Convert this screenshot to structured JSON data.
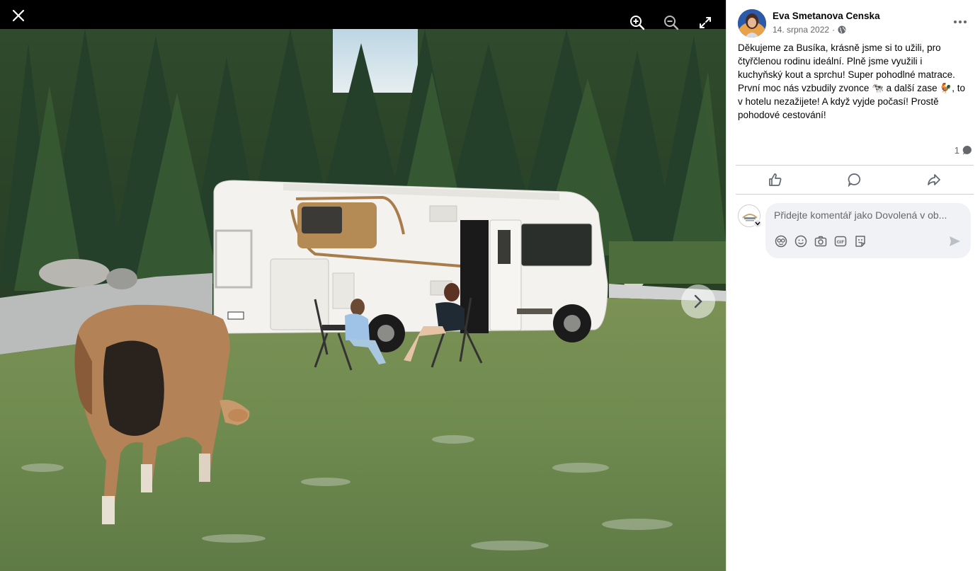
{
  "viewer": {
    "close_icon": "close-icon",
    "zoom_in_icon": "zoom-in-icon",
    "zoom_out_icon": "zoom-out-icon",
    "fullscreen_icon": "fullscreen-icon",
    "next_icon": "chevron-right-icon",
    "photo_description_icon": "photo"
  },
  "post": {
    "author": "Eva Smetanova Censka",
    "date": "14. srpna 2022",
    "separator": "·",
    "audience_icon": "globe-icon",
    "more_icon": "more-icon",
    "text_lines": [
      "Děkujeme za Busíka, krásně jsme si to užili, pro",
      "čtyřčlenou rodinu ideální. Plně jsme využili i",
      "kuchyňský kout a sprchu! Super pohodlné matrace.",
      "První moc nás vzbudily zvonce 🐄 a další zase 🐓, to",
      "v hotelu nezažijete! A když vyjde počasí! Prostě",
      "pohodové cestování!"
    ],
    "comment_count": "1"
  },
  "actions": {
    "like_icon": "thumbs-up-icon",
    "comment_icon": "comment-icon",
    "share_icon": "share-icon"
  },
  "comment": {
    "placeholder": "Přidejte komentář jako Dovolená v ob...",
    "tools": [
      "sticker-icon",
      "emoji-icon",
      "camera-icon",
      "gif-icon",
      "avatar-sticker-icon"
    ],
    "send_icon": "send-icon"
  },
  "colors": {
    "accent": "#1877f2",
    "secondary_text": "#65676b",
    "input_bg": "#f0f2f5"
  }
}
